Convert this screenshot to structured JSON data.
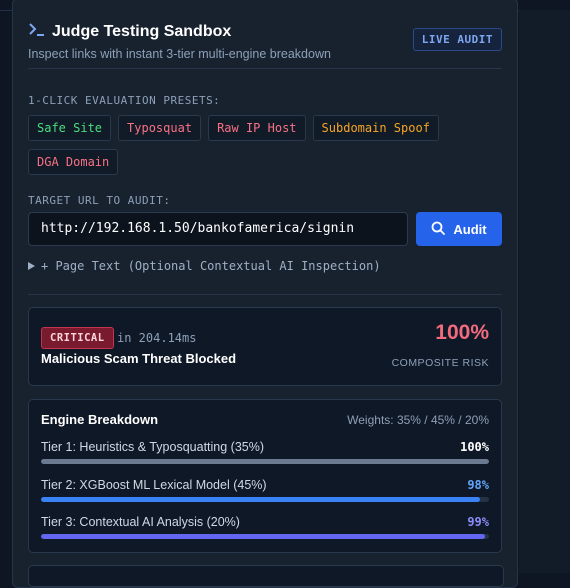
{
  "header": {
    "title": "Judge Testing Sandbox",
    "subtitle": "Inspect links with instant 3-tier multi-engine breakdown",
    "badge": "LIVE AUDIT"
  },
  "presets": {
    "label": "1-CLICK EVALUATION PRESETS:",
    "items": [
      {
        "label": "Safe Site",
        "color": "#4ade80"
      },
      {
        "label": "Typosquat",
        "color": "#f87185"
      },
      {
        "label": "Raw IP Host",
        "color": "#f87185"
      },
      {
        "label": "Subdomain Spoof",
        "color": "#f5a524"
      },
      {
        "label": "DGA Domain",
        "color": "#f87185"
      }
    ]
  },
  "target": {
    "label": "TARGET URL TO AUDIT:",
    "url": "http://192.168.1.50/bankofamerica/signin",
    "audit_label": "Audit"
  },
  "page_text": {
    "label": "+ Page Text (Optional Contextual AI Inspection)"
  },
  "result": {
    "severity": "CRITICAL",
    "latency": "in 204.14ms",
    "title": "Malicious Scam Threat Blocked",
    "risk_value": "100%",
    "risk_label": "COMPOSITE RISK"
  },
  "engine": {
    "title": "Engine Breakdown",
    "weights": "Weights: 35% / 45% / 20%",
    "tiers": [
      {
        "name": "Tier 1: Heuristics & Typosquatting (35%)",
        "value": "100%",
        "percent": 100,
        "color": "#6b7a91",
        "value_color": "#ffffff"
      },
      {
        "name": "Tier 2: XGBoost ML Lexical Model (45%)",
        "value": "98%",
        "percent": 98,
        "color": "#3b82f6",
        "value_color": "#60a5fa"
      },
      {
        "name": "Tier 3: Contextual AI Analysis (20%)",
        "value": "99%",
        "percent": 99,
        "color": "#6366f1",
        "value_color": "#8b8cf8"
      }
    ]
  }
}
